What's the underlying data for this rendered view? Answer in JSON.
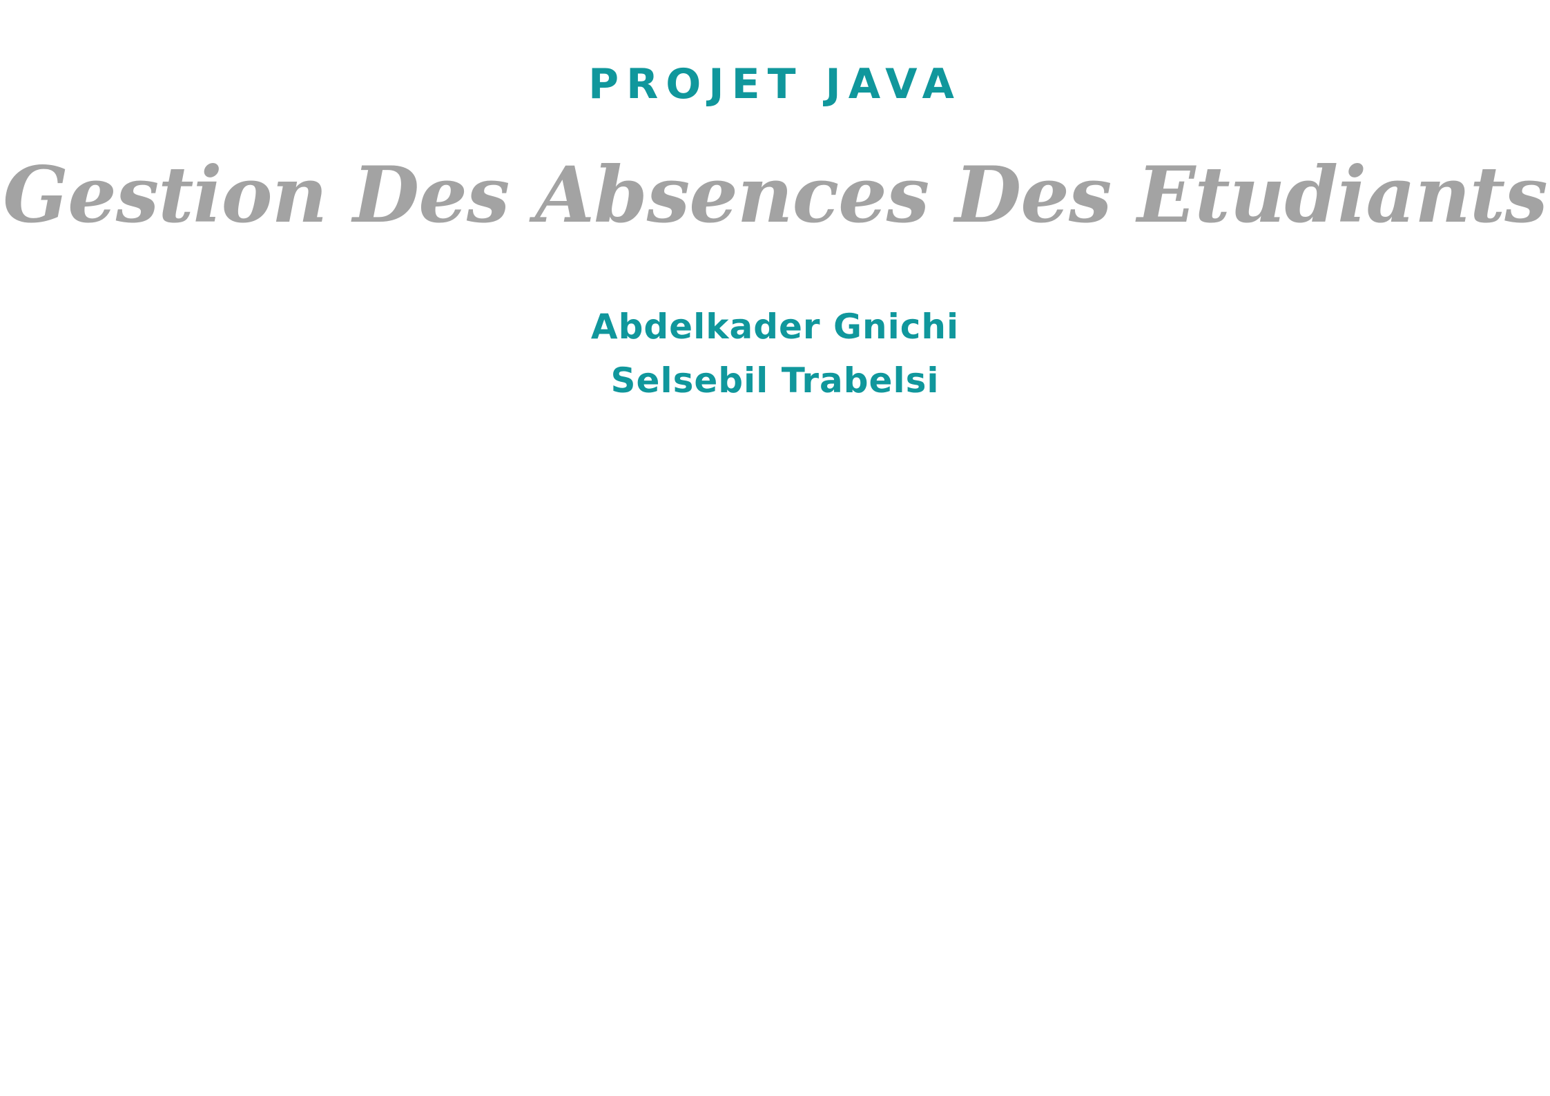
{
  "document": {
    "kicker": "PROJET JAVA",
    "title": "Gestion Des Absences Des Etudiants",
    "authors": [
      "Abdelkader Gnichi",
      "Selsebil Trabelsi"
    ]
  },
  "colors": {
    "accent": "#10979c",
    "title": "#a3a3a3",
    "background": "#ffffff"
  }
}
